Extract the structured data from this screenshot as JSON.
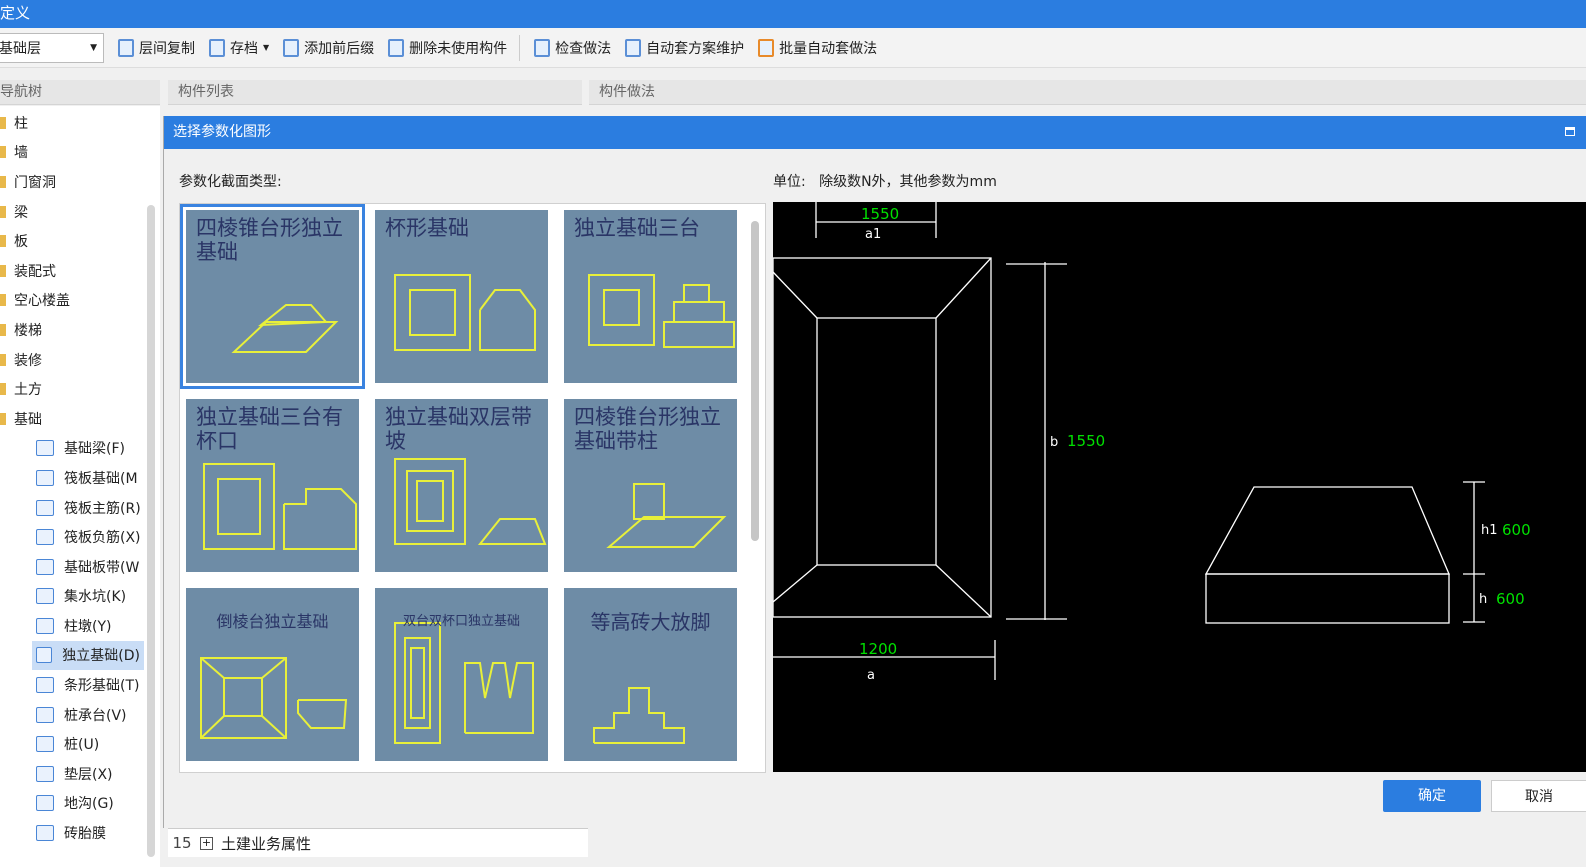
{
  "window": {
    "title": "定义"
  },
  "toolbar": {
    "floor": "基础层",
    "items": [
      "层间复制",
      "存档",
      "添加前后缀",
      "删除未使用构件",
      "检查做法",
      "自动套方案维护",
      "批量自动套做法"
    ]
  },
  "panes": {
    "nav": "导航树",
    "list": "构件列表",
    "method": "构件做法"
  },
  "tree": {
    "folders": [
      "柱",
      "墙",
      "门窗洞",
      "梁",
      "板",
      "装配式",
      "空心楼盖",
      "楼梯",
      "装修",
      "土方",
      "基础"
    ],
    "children": [
      "基础梁(F)",
      "筏板基础(M",
      "筏板主筋(R)",
      "筏板负筋(X)",
      "基础板带(W",
      "集水坑(K)",
      "柱墩(Y)",
      "独立基础(D)",
      "条形基础(T)",
      "桩承台(V)",
      "桩(U)",
      "垫层(X)",
      "地沟(G)",
      "砖胎膜"
    ],
    "selected": "独立基础(D)"
  },
  "dialog": {
    "title": "选择参数化图形",
    "section_label": "参数化截面类型:",
    "unit_label": "单位:",
    "unit_text": "除级数N外，其他参数为mm",
    "shapes": [
      "四棱锥台形独立基础",
      "杯形基础",
      "独立基础三台",
      "独立基础三台有杯口",
      "独立基础双层带坡",
      "四棱锥台形独立基础带柱",
      "倒棱台独立基础",
      "双台双杯口独立基础",
      "等高砖大放脚"
    ],
    "selected_shape": "四棱锥台形独立基础",
    "preview": {
      "a1": "1550",
      "b": "1550",
      "a": "1200",
      "h1": "600",
      "h": "600",
      "labels": {
        "a1": "a1",
        "b": "b",
        "a": "a",
        "h1": "h1",
        "h": "h"
      }
    },
    "ok": "确定",
    "cancel": "取消"
  },
  "bottom": {
    "row": "15",
    "expand": "+",
    "label": "土建业务属性"
  },
  "colors": {
    "accent": "#2b7de0",
    "preview_bg": "#000000",
    "dim_value": "#00e000",
    "tile_bg": "#6e8ca6",
    "tile_line": "#e8f03a"
  }
}
